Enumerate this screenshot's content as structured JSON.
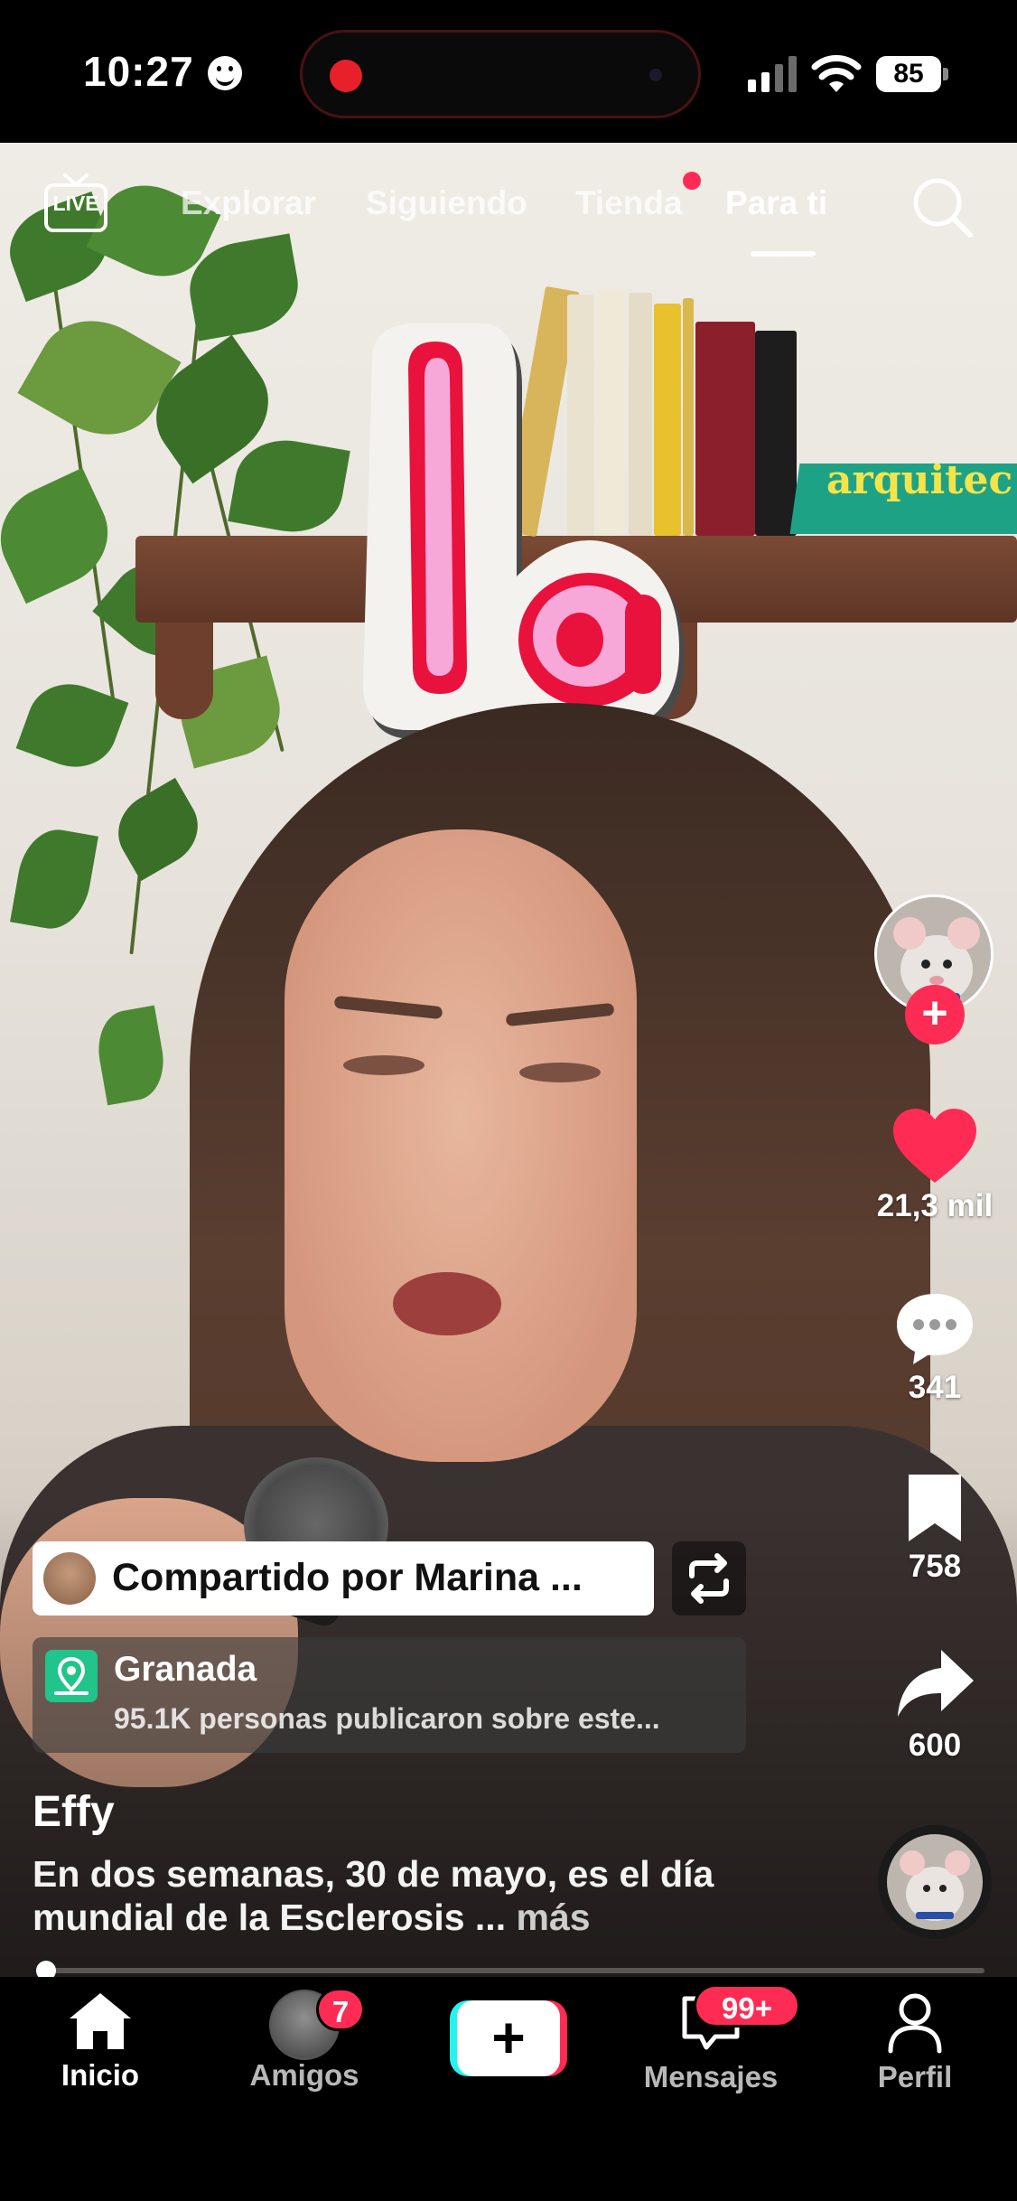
{
  "status_bar": {
    "time": "10:27",
    "battery": "85"
  },
  "top_nav": {
    "live_label": "LIVE",
    "tabs": [
      {
        "label": "Explorar"
      },
      {
        "label": "Siguiendo"
      },
      {
        "label": "Tienda"
      },
      {
        "label": "Para ti"
      }
    ],
    "active_tab": "Para ti"
  },
  "video": {
    "sticker_text": "la",
    "book_text": "arquitec"
  },
  "right_rail": {
    "likes": "21,3 mil",
    "comments": "341",
    "saves": "758",
    "shares": "600"
  },
  "post": {
    "shared_by": "Compartido por Marina ...",
    "location_title": "Granada",
    "location_subtitle": "95.1K personas publicaron sobre este...",
    "username": "Effy",
    "caption": "En dos semanas, 30 de mayo, es el día mundial de la Esclerosis ...",
    "more_label": "más",
    "progress": 0.01
  },
  "bottom_nav": {
    "tabs": [
      {
        "label": "Inicio",
        "icon": "home-icon"
      },
      {
        "label": "Amigos",
        "icon": "friends-avatar"
      },
      {
        "label": "",
        "icon": "create-icon"
      },
      {
        "label": "Mensajes",
        "icon": "inbox-icon"
      },
      {
        "label": "Perfil",
        "icon": "profile-icon"
      }
    ],
    "friends_badge": "7",
    "messages_badge": "99+",
    "active_tab": "Inicio"
  },
  "colors": {
    "accent": "#fe2c55",
    "cyan": "#25f4ee",
    "location_icon": "#21c48b"
  }
}
